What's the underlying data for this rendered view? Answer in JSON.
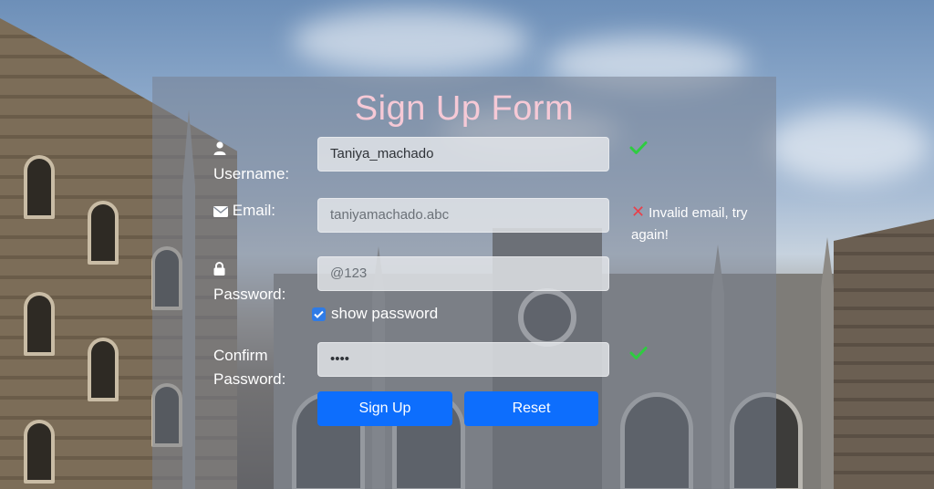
{
  "form": {
    "title": "Sign Up Form",
    "username": {
      "label": "Username:",
      "value": "Taniya_machado",
      "status": "valid"
    },
    "email": {
      "label": "Email:",
      "value": "taniyamachado.abc",
      "status": "invalid",
      "error": "Invalid email, try again!"
    },
    "password": {
      "label": "Password:",
      "value": "@123"
    },
    "show_password": {
      "label": "show password",
      "checked": true
    },
    "confirm_password": {
      "label_line1": "Confirm",
      "label_line2": "Password:",
      "value": "••••",
      "status": "valid"
    },
    "buttons": {
      "signup": "Sign Up",
      "reset": "Reset"
    }
  },
  "icons": {
    "username": "user-icon",
    "email": "envelope-icon",
    "password": "lock-icon",
    "valid": "check-icon",
    "invalid": "x-icon"
  },
  "colors": {
    "title": "#f6c9d6",
    "accent": "#0d6efd",
    "valid": "#2ecc40",
    "invalid": "#e8414b"
  }
}
